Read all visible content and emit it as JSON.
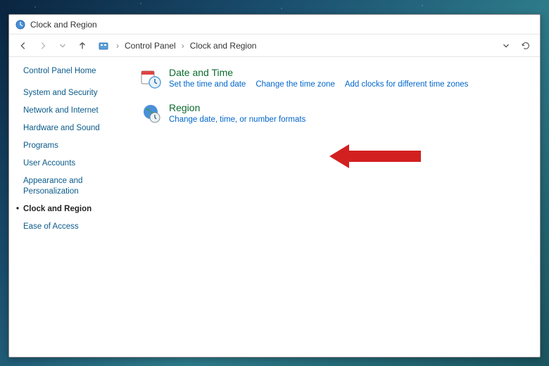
{
  "titlebar": {
    "title": "Clock and Region"
  },
  "toolbar": {
    "breadcrumb": [
      "Control Panel",
      "Clock and Region"
    ]
  },
  "sidebar": {
    "home": "Control Panel Home",
    "items": [
      "System and Security",
      "Network and Internet",
      "Hardware and Sound",
      "Programs",
      "User Accounts",
      "Appearance and Personalization",
      "Clock and Region",
      "Ease of Access"
    ],
    "active_index": 6
  },
  "main": {
    "categories": [
      {
        "title": "Date and Time",
        "links": [
          "Set the time and date",
          "Change the time zone",
          "Add clocks for different time zones"
        ]
      },
      {
        "title": "Region",
        "links": [
          "Change date, time, or number formats"
        ]
      }
    ]
  },
  "annotation": {
    "arrow_color": "#d22020"
  }
}
